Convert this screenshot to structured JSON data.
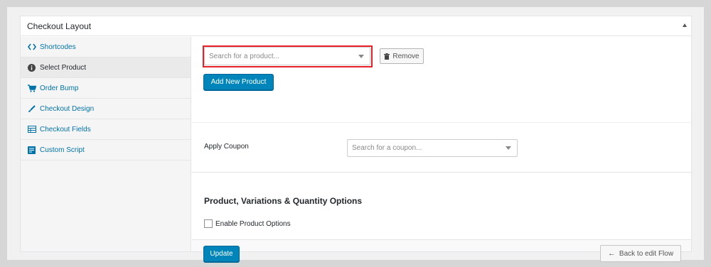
{
  "panel": {
    "title": "Checkout Layout"
  },
  "sidebar": {
    "items": [
      {
        "label": "Shortcodes",
        "icon": "code-icon"
      },
      {
        "label": "Select Product",
        "icon": "info-icon",
        "active": true
      },
      {
        "label": "Order Bump",
        "icon": "cart-icon"
      },
      {
        "label": "Checkout Design",
        "icon": "brush-icon"
      },
      {
        "label": "Checkout Fields",
        "icon": "table-icon"
      },
      {
        "label": "Custom Script",
        "icon": "script-icon"
      }
    ]
  },
  "product": {
    "search_placeholder": "Search for a product...",
    "remove_label": "Remove",
    "add_new_label": "Add New Product"
  },
  "coupon": {
    "label": "Apply Coupon",
    "search_placeholder": "Search for a coupon..."
  },
  "options": {
    "heading": "Product, Variations & Quantity Options",
    "enable_label": "Enable Product Options"
  },
  "footer": {
    "update_label": "Update",
    "back_label": "Back to edit Flow"
  },
  "colors": {
    "accent": "#0085ba",
    "highlight": "#e8202a",
    "link": "#0073aa"
  }
}
